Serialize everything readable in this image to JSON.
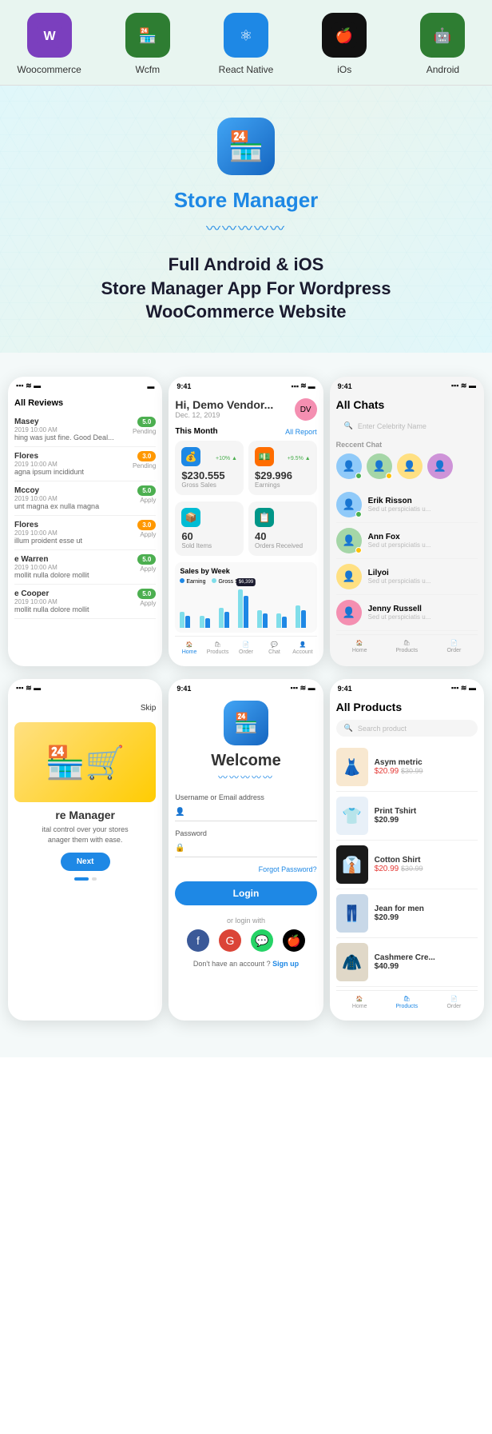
{
  "nav": {
    "items": [
      {
        "id": "woocommerce",
        "label": "Woocommerce",
        "icon": "🛒",
        "iconClass": "woo"
      },
      {
        "id": "wcfm",
        "label": "Wcfm",
        "icon": "🏪",
        "iconClass": "wcfm"
      },
      {
        "id": "react-native",
        "label": "React Native",
        "icon": "⚛",
        "iconClass": "rn"
      },
      {
        "id": "ios",
        "label": "iOs",
        "icon": "🍎",
        "iconClass": "ios"
      },
      {
        "id": "android",
        "label": "Android",
        "icon": "🤖",
        "iconClass": "android"
      }
    ]
  },
  "hero": {
    "title": "Store Manager",
    "wave": "〰〰〰〰〰",
    "subtitle": "Full Android & iOS\nStore Manager App For Wordpress\nWooCommerce Website",
    "icon": "🏪"
  },
  "screen1": {
    "title": "All Reviews",
    "reviews": [
      {
        "name": "Masey",
        "date": "2019 10:00 AM",
        "text": "hing was just fine. Good Deal...",
        "badge": "5.0",
        "status": "Pending",
        "type": "green"
      },
      {
        "name": "Flores",
        "date": "2019 10:00 AM",
        "text": "agna ipsum incididunt",
        "badge": "3.0",
        "status": "Pending",
        "type": "orange"
      },
      {
        "name": "Mccoy",
        "date": "2019 10:00 AM",
        "text": "unt magna ex nulla magna",
        "badge": "5.0",
        "status": "Apply",
        "type": "green"
      },
      {
        "name": "Flores",
        "date": "2019 10:00 AM",
        "text": "illum proident esse ut",
        "badge": "3.0",
        "status": "Apply",
        "type": "orange"
      },
      {
        "name": "e Warren",
        "date": "2019 10:00 AM",
        "text": "mollit nulla dolore mollit",
        "badge": "5.0",
        "status": "Apply",
        "type": "green"
      },
      {
        "name": "e Cooper",
        "date": "2019 10:00 AM",
        "text": "mollit nulla dolore mollit",
        "badge": "5.0",
        "status": "Apply",
        "type": "green"
      }
    ]
  },
  "screen2": {
    "greeting": "Hi, Demo Vendor...",
    "date": "Dec. 12, 2019",
    "avatar_label": "DV",
    "this_month": "This Month",
    "all_report": "All Report",
    "stats": [
      {
        "icon": "💰",
        "iconClass": "blue",
        "value": "$230.555",
        "label": "Gross Sales",
        "delta": "+10%"
      },
      {
        "icon": "💵",
        "iconClass": "orange",
        "value": "$29.996",
        "label": "Earnings",
        "delta": "+9.5%"
      }
    ],
    "stats2": [
      {
        "icon": "📦",
        "iconClass": "green",
        "value": "60",
        "label": "Sold Items"
      },
      {
        "icon": "📋",
        "iconClass": "teal",
        "value": "40",
        "label": "Orders Received"
      }
    ],
    "chart_title": "Sales by Week",
    "legend": [
      {
        "label": "Earning",
        "color": "#1e88e5"
      },
      {
        "label": "Gross Sales",
        "color": "#80deea"
      }
    ],
    "chart_highlight": "$6,399",
    "bars": [
      {
        "earn": 20,
        "gross": 25
      },
      {
        "earn": 15,
        "gross": 20
      },
      {
        "earn": 25,
        "gross": 30
      },
      {
        "earn": 40,
        "gross": 48
      },
      {
        "earn": 20,
        "gross": 22
      },
      {
        "earn": 15,
        "gross": 18
      },
      {
        "earn": 22,
        "gross": 28
      }
    ],
    "bottom_nav": [
      {
        "label": "Home",
        "active": true
      },
      {
        "label": "Products",
        "active": false
      },
      {
        "label": "Order",
        "active": false
      },
      {
        "label": "Chat",
        "active": false
      },
      {
        "label": "Account",
        "active": false
      }
    ]
  },
  "screen3": {
    "title": "All Chats",
    "search_placeholder": "Enter Celebrity Name",
    "recent_label": "Reccent Chat",
    "chats": [
      {
        "name": "Erik Risson",
        "sub": "Sed ut perspiciatis u...",
        "online": true,
        "dot_color": "green"
      },
      {
        "name": "Ann Fox",
        "sub": "Sed ut perspiciatis u...",
        "online": true,
        "dot_color": "yellow"
      },
      {
        "name": "Lilyoi",
        "sub": "Sed ut perspiciatis u...",
        "online": false
      },
      {
        "name": "Jenny Russell",
        "sub": "Sed ut perspiciatis u...",
        "online": false
      }
    ],
    "bottom_nav": [
      {
        "label": "Home",
        "active": false
      },
      {
        "label": "Products",
        "active": false
      },
      {
        "label": "Order",
        "active": false
      }
    ]
  },
  "screen4": {
    "skip": "Skip",
    "title": "re Manager",
    "desc": "ital control over your stores\nanager them with ease.",
    "next": "Next"
  },
  "screen5": {
    "title": "Welcome",
    "wave": "〰〰〰〰〰",
    "username_label": "Username or Email address",
    "password_label": "Password",
    "forgot": "Forgot Password?",
    "login_btn": "Login",
    "or_text": "or login with",
    "signup_text": "Don't have an account ?",
    "signup_link": "Sign up"
  },
  "screen6": {
    "title": "All Products",
    "search_placeholder": "Search product",
    "products": [
      {
        "name": "Asym metric",
        "price": "$20.99",
        "old_price": "$30.99",
        "has_old": true
      },
      {
        "name": "Print Tshirt",
        "price": "$20.99",
        "has_old": false
      },
      {
        "name": "Cotton Shirt",
        "price": "$20.99",
        "old_price": "$30.99",
        "has_old": true
      },
      {
        "name": "Jean for men",
        "price": "$20.99",
        "has_old": false
      },
      {
        "name": "Cashmere Cre...",
        "price": "$40.99",
        "has_old": false
      }
    ],
    "bottom_nav": [
      {
        "label": "Home",
        "active": false
      },
      {
        "label": "Products",
        "active": true
      },
      {
        "label": "Order",
        "active": false
      }
    ]
  }
}
